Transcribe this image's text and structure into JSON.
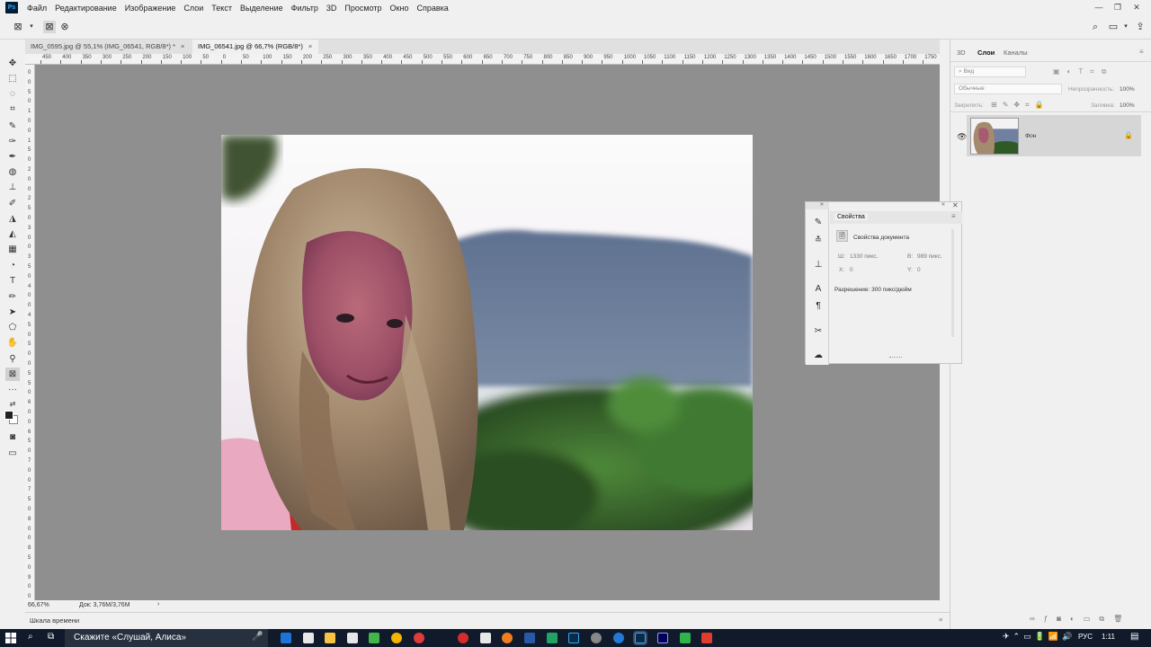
{
  "menu": {
    "logo": "Ps",
    "items": [
      "Файл",
      "Редактирование",
      "Изображение",
      "Слои",
      "Текст",
      "Выделение",
      "Фильтр",
      "3D",
      "Просмотр",
      "Окно",
      "Справка"
    ]
  },
  "tabs": [
    {
      "label": "IMG_0595.jpg @ 55,1% (IMG_06541, RGB/8*) *",
      "close": "×",
      "active": false
    },
    {
      "label": "IMG_06541.jpg @ 66,7% (RGB/8*)",
      "close": "×",
      "active": true
    }
  ],
  "ruler_top": [
    "450",
    "400",
    "350",
    "300",
    "250",
    "200",
    "150",
    "100",
    "50",
    "0",
    "50",
    "100",
    "150",
    "200",
    "250",
    "300",
    "350",
    "400",
    "450",
    "500",
    "550",
    "600",
    "650",
    "700",
    "750",
    "800",
    "850",
    "900",
    "950",
    "1000",
    "1050",
    "1100",
    "1150",
    "1200",
    "1250",
    "1300",
    "1350",
    "1400",
    "1450",
    "1500",
    "1550",
    "1600",
    "1650",
    "1700",
    "1750"
  ],
  "ruler_left": [
    "0",
    "0",
    "5",
    "0",
    "1",
    "0",
    "0",
    "1",
    "5",
    "0",
    "2",
    "0",
    "0",
    "2",
    "5",
    "0",
    "3",
    "0",
    "0",
    "3",
    "5",
    "0",
    "4",
    "0",
    "0",
    "4",
    "5",
    "0",
    "5",
    "0",
    "0",
    "5",
    "5",
    "0",
    "6",
    "0",
    "0",
    "6",
    "5",
    "0",
    "7",
    "0",
    "0",
    "7",
    "5",
    "0",
    "8",
    "0",
    "0",
    "8",
    "5",
    "0",
    "9",
    "0",
    "0"
  ],
  "status": {
    "zoom": "66,67%",
    "doc": "Док: 3,76M/3,76M",
    "arrow": "›"
  },
  "timeline": {
    "label": "Шкала времени"
  },
  "right_panel": {
    "tabs": [
      "3D",
      "Слои",
      "Каналы"
    ],
    "active_tab": "Слои",
    "filter_placeholder": "Вид",
    "blend_mode": "Обычные",
    "opacity_label": "Непрозрачность:",
    "opacity_value": "100%",
    "lock_label": "Закрепить:",
    "fill_label": "Заливка:",
    "fill_value": "100%",
    "layer_name": "Фон"
  },
  "properties": {
    "title": "Свойства",
    "section": "Свойства документа",
    "w_label": "Ш:",
    "w_value": "1330 пикс.",
    "h_label": "В:",
    "h_value": "989 пикс.",
    "x_label": "X:",
    "x_value": "0",
    "y_label": "Y:",
    "y_value": "0",
    "resolution": "Разрешение: 300 пикс/дюйм"
  },
  "taskbar": {
    "search_text": "Скажите «Слушай, Алиса»",
    "language": "РУС",
    "time": "1:11"
  },
  "colors": {
    "canvas_bg": "#8f8f8f",
    "taskbar_bg": "#101a2b",
    "ps_blue": "#31a8ff"
  }
}
